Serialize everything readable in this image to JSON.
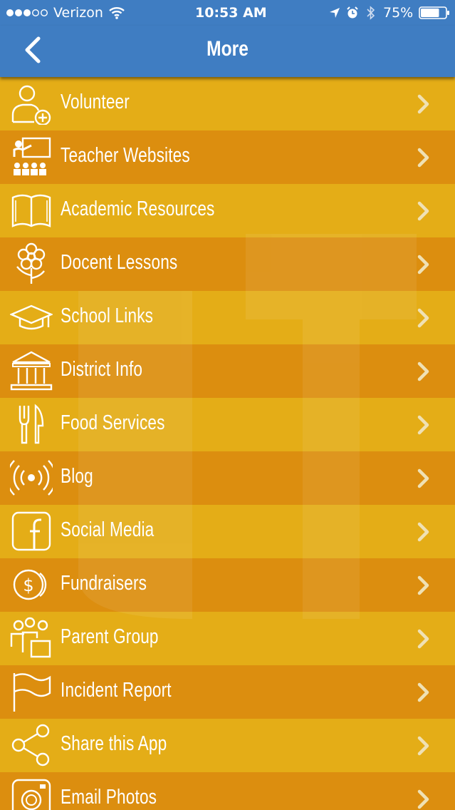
{
  "status_bar": {
    "carrier": "Verizon",
    "time": "10:53 AM",
    "battery": "75%",
    "signal_icon": "signal-dots-icon",
    "wifi_icon": "wifi-icon",
    "location_icon": "location-arrow-icon",
    "alarm_icon": "alarm-icon",
    "bluetooth_icon": "bluetooth-icon",
    "battery_icon": "battery-icon",
    "battery_level": 0.75
  },
  "nav": {
    "title": "More",
    "back_icon": "back-chevron-icon"
  },
  "colors": {
    "nav_blue": "#3f7dc2",
    "row_light": "#e4ad17",
    "row_dark": "#dc8e0f",
    "chevron": "#f0e1b4"
  },
  "menu": [
    {
      "label": "Volunteer",
      "icon": "volunteer-icon"
    },
    {
      "label": "Teacher Websites",
      "icon": "teacher-icon"
    },
    {
      "label": "Academic Resources",
      "icon": "book-icon"
    },
    {
      "label": "Docent Lessons",
      "icon": "flower-icon"
    },
    {
      "label": "School Links",
      "icon": "graduation-cap-icon"
    },
    {
      "label": "District Info",
      "icon": "building-icon"
    },
    {
      "label": "Food Services",
      "icon": "fork-knife-icon"
    },
    {
      "label": "Blog",
      "icon": "broadcast-icon"
    },
    {
      "label": "Social Media",
      "icon": "facebook-icon"
    },
    {
      "label": "Fundraisers",
      "icon": "dollar-coin-icon"
    },
    {
      "label": "Parent Group",
      "icon": "people-group-icon"
    },
    {
      "label": "Incident Report",
      "icon": "flag-icon"
    },
    {
      "label": "Share this App",
      "icon": "share-icon"
    },
    {
      "label": "Email Photos",
      "icon": "camera-icon"
    }
  ]
}
